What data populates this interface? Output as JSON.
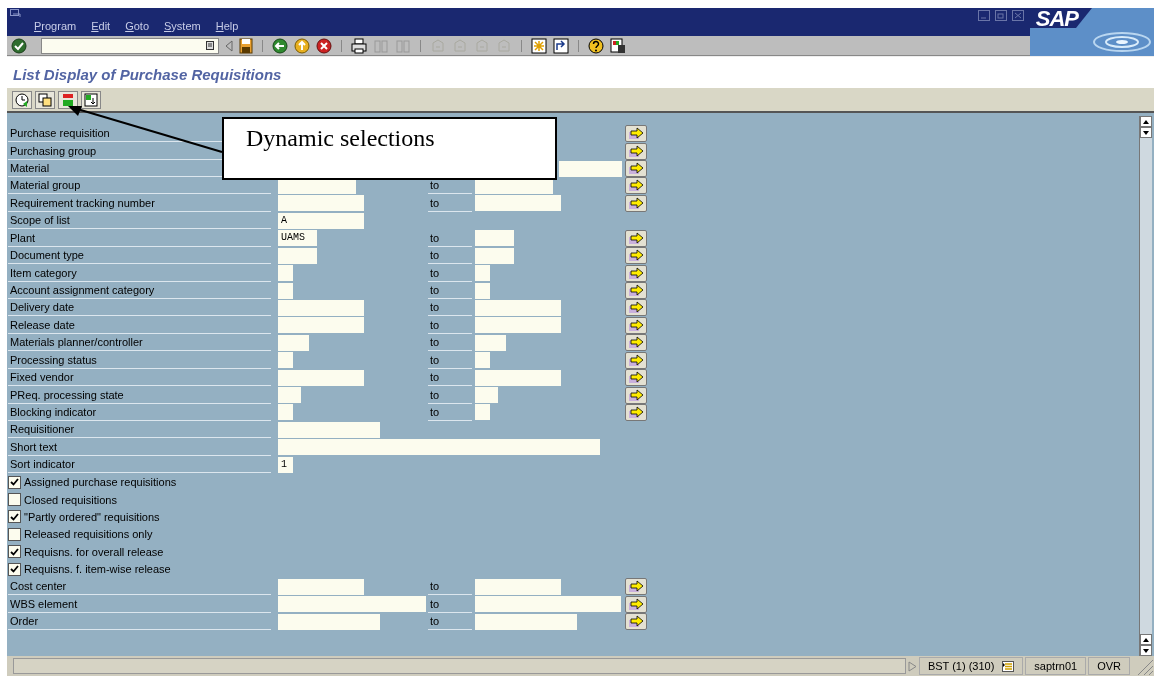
{
  "logo": "SAP",
  "menu": [
    {
      "label": "Program"
    },
    {
      "label": "Edit"
    },
    {
      "label": "Goto"
    },
    {
      "label": "System"
    },
    {
      "label": "Help"
    }
  ],
  "title": "List Display of Purchase Requisitions",
  "callout": {
    "text": "Dynamic selections"
  },
  "rows": [
    {
      "kind": "covered",
      "label": "Purchase requisition"
    },
    {
      "kind": "covered",
      "label": "Purchasing group"
    },
    {
      "kind": "partly_covered",
      "label": "Material"
    },
    {
      "kind": "range",
      "label": "Material group",
      "to_label": "to"
    },
    {
      "kind": "range",
      "label": "Requirement tracking number",
      "to_label": "to"
    },
    {
      "kind": "single",
      "label": "Scope of list",
      "value": "A"
    },
    {
      "kind": "range",
      "label": "Plant",
      "value": "UAMS",
      "to_label": "to"
    },
    {
      "kind": "range",
      "label": "Document type",
      "to_label": "to"
    },
    {
      "kind": "range",
      "label": "Item category",
      "to_label": "to"
    },
    {
      "kind": "range",
      "label": "Account assignment category",
      "to_label": "to"
    },
    {
      "kind": "range",
      "label": "Delivery date",
      "to_label": "to"
    },
    {
      "kind": "range",
      "label": "Release date",
      "to_label": "to"
    },
    {
      "kind": "range",
      "label": "Materials planner/controller",
      "to_label": "to"
    },
    {
      "kind": "range",
      "label": "Processing status",
      "to_label": "to"
    },
    {
      "kind": "range",
      "label": "Fixed vendor",
      "to_label": "to"
    },
    {
      "kind": "range",
      "label": "PReq. processing state",
      "to_label": "to"
    },
    {
      "kind": "range",
      "label": "Blocking indicator",
      "to_label": "to"
    },
    {
      "kind": "single",
      "label": "Requisitioner"
    },
    {
      "kind": "single",
      "label": "Short text"
    },
    {
      "kind": "single",
      "label": "Sort indicator",
      "value": "1"
    },
    {
      "kind": "checkbox",
      "label": "Assigned purchase requisitions",
      "checked": true
    },
    {
      "kind": "checkbox",
      "label": "Closed requisitions",
      "checked": false
    },
    {
      "kind": "checkbox",
      "label": "\"Partly ordered\" requisitions",
      "checked": true
    },
    {
      "kind": "checkbox",
      "label": "Released requisitions only",
      "checked": false
    },
    {
      "kind": "checkbox",
      "label": "Requisns. for overall release",
      "checked": true
    },
    {
      "kind": "checkbox",
      "label": "Requisns. f. item-wise release",
      "checked": true
    },
    {
      "kind": "range",
      "label": "Cost center",
      "to_label": "to"
    },
    {
      "kind": "range",
      "label": "WBS element",
      "to_label": "to"
    },
    {
      "kind": "range",
      "label": "Order",
      "to_label": "to"
    }
  ],
  "status_bar": {
    "system": "BST (1) (310)",
    "server": "saptrn01",
    "mode": "OVR"
  }
}
